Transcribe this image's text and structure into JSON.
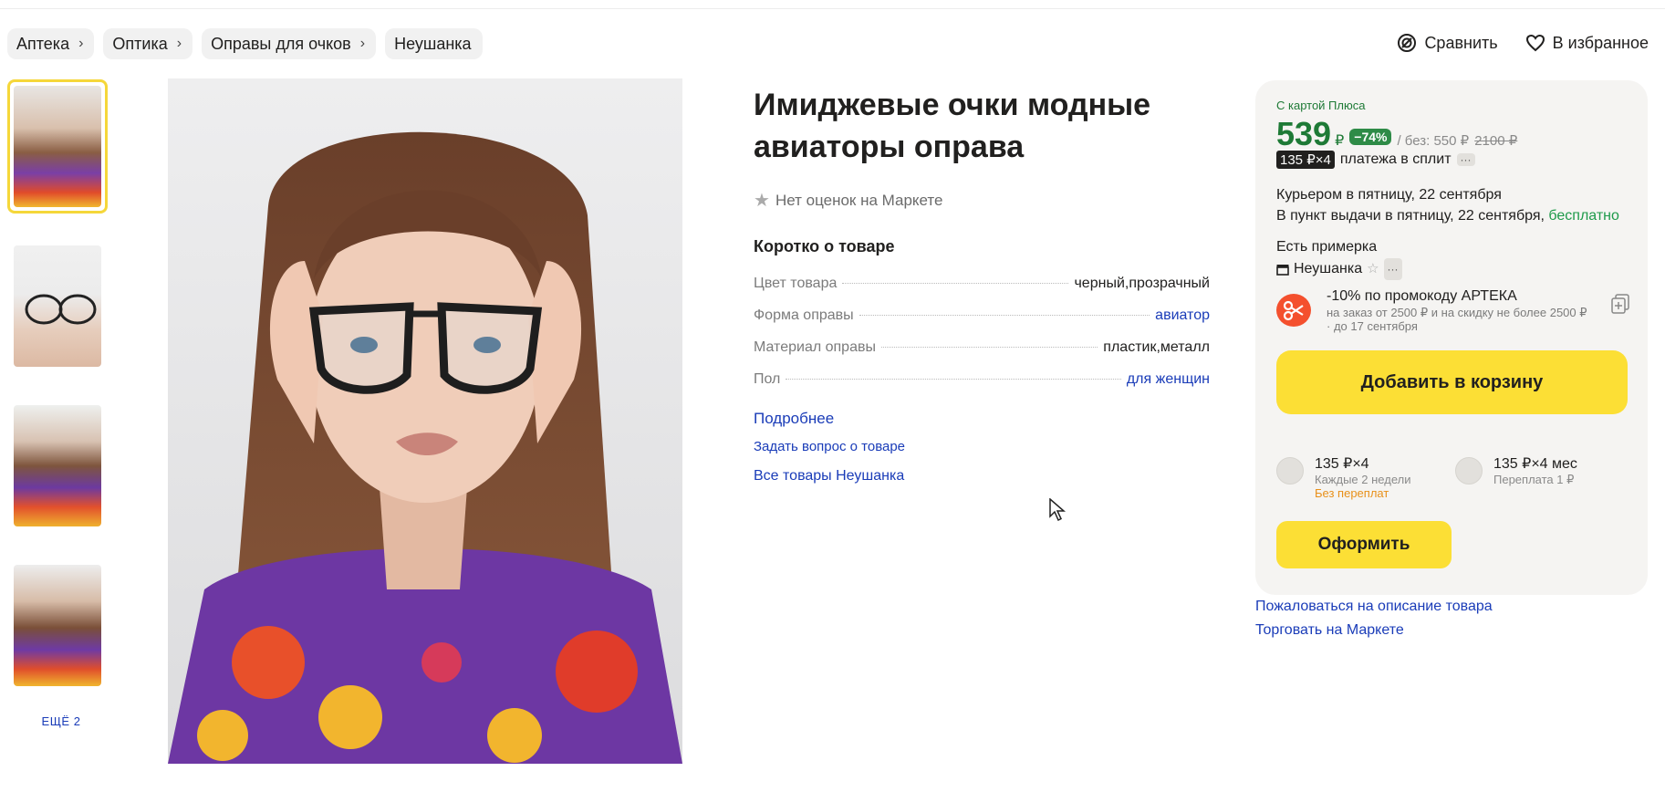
{
  "breadcrumbs": [
    "Аптека",
    "Оптика",
    "Оправы для очков",
    "Неушанка"
  ],
  "top_actions": {
    "compare": "Сравнить",
    "favorite": "В избранное"
  },
  "gallery": {
    "more_label": "ЕЩЁ 2",
    "thumb_count": 4
  },
  "product": {
    "title": "Имиджевые очки модные авиаторы оправа",
    "rating_text": "Нет оценок на Маркете",
    "specs_heading": "Коротко о товаре",
    "specs": [
      {
        "key": "Цвет товара",
        "value": "черный,прозрачный",
        "link": false
      },
      {
        "key": "Форма оправы",
        "value": "авиатор",
        "link": true
      },
      {
        "key": "Материал оправы",
        "value": "пластик,металл",
        "link": false
      },
      {
        "key": "Пол",
        "value": "для женщин",
        "link": true
      }
    ],
    "more_link": "Подробнее",
    "ask_link": "Задать вопрос о товаре",
    "all_goods_link": "Все товары Неушанка"
  },
  "buy": {
    "plus_label": "С картой Плюса",
    "price": "539",
    "currency": "₽",
    "discount": "−74%",
    "without_label": "/ без: 550 ₽",
    "old_price": "2100 ₽",
    "split_badge": "135 ₽×4",
    "split_text": "платежа в сплит",
    "more_dots": "···",
    "delivery_courier": "Курьером в пятницу, 22 сентября",
    "delivery_pickup": "В пункт выдачи в пятницу, 22 сентября,",
    "delivery_free": "бесплатно",
    "fitting": "Есть примерка",
    "shop_name": "Неушанка",
    "promo_title": "-10% по промокоду АРТЕКА",
    "promo_sub": "на заказ от 2500 ₽ и на скидку не более 2500 ₽ · до 17 сентября",
    "cart_button": "Добавить в корзину",
    "plans": [
      {
        "amount": "135 ₽×4",
        "period": "Каждые 2 недели",
        "note": "Без переплат"
      },
      {
        "amount": "135 ₽×4 мес",
        "period": "Переплата 1 ₽",
        "note": ""
      }
    ],
    "order_button": "Оформить"
  },
  "footer_links": {
    "complain": "Пожаловаться на описание товара",
    "sell": "Торговать на Маркете"
  },
  "colors": {
    "accent_yellow": "#fcdf35",
    "price_green": "#1e7a36",
    "link_blue": "#1a3cb8",
    "promo_red": "#f4502e"
  }
}
